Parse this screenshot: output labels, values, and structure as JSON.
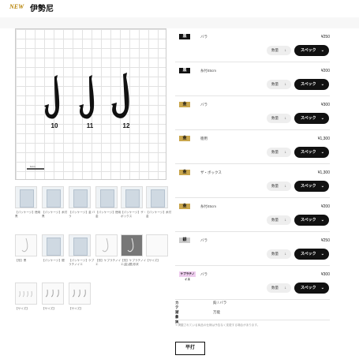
{
  "header": {
    "badge": "NEW",
    "title": "伊勢尼"
  },
  "main_image": {
    "hooks": [
      "10",
      "11",
      "12"
    ],
    "scale_label": "1mm"
  },
  "thumbnails": [
    {
      "caption": "【パッケージ】徳用 黒"
    },
    {
      "caption": "【パッケージ】糸付 黒"
    },
    {
      "caption": "【パッケージ】金 バラ"
    },
    {
      "caption": "【パッケージ】徳用 金"
    },
    {
      "caption": "【パッケージ】ザ・ボックス"
    },
    {
      "caption": "【パッケージ】糸付 金"
    },
    {
      "caption": "【形】黒"
    },
    {
      "caption": "【パッケージ】銀"
    },
    {
      "caption": "【パッケージ】ケプラチノイエ"
    },
    {
      "caption": "【形】ケプラチノイエ"
    },
    {
      "caption": "【形】ケプラチノイエ(金)(銀)形状"
    },
    {
      "caption": "【サイズ】"
    },
    {
      "caption": "【サイズ】"
    },
    {
      "caption": "【サイズ】"
    },
    {
      "caption": "【サイズ】"
    }
  ],
  "products": [
    {
      "badge": "黒",
      "badge_color": "#111111",
      "label": "バラ",
      "price": "¥250",
      "qty": "数量",
      "spec": "スペック"
    },
    {
      "badge": "黒",
      "badge_color": "#111111",
      "label": "糸付45cm",
      "price": "¥200",
      "qty": "数量",
      "spec": "スペック"
    },
    {
      "badge": "金",
      "badge_color": "#c9a64d",
      "label": "バラ",
      "price": "¥300",
      "qty": "数量",
      "spec": "スペック"
    },
    {
      "badge": "金",
      "badge_color": "#c9a64d",
      "label": "徳用",
      "price": "¥1,300",
      "qty": "数量",
      "spec": "スペック"
    },
    {
      "badge": "金",
      "badge_color": "#c9a64d",
      "label": "ザ・ボックス",
      "price": "¥1,300",
      "qty": "数量",
      "spec": "スペック"
    },
    {
      "badge": "金",
      "badge_color": "#c9a64d",
      "label": "糸付45cm",
      "price": "¥200",
      "qty": "数量",
      "spec": "スペック"
    },
    {
      "badge": "銀",
      "badge_color": "#cccccc",
      "label": "バラ",
      "price": "¥250",
      "qty": "数量",
      "spec": "スペック"
    },
    {
      "badge": "ケプラチノイエ",
      "badge_color": "#eeccee",
      "label": "バラ",
      "price": "¥300",
      "qty": "数量",
      "spec": "スペック"
    }
  ],
  "meta": {
    "category_key": "カテゴリ",
    "category_value": "鈎 / バラ",
    "type_key": "対象魚",
    "type_value": "万能"
  },
  "note": "※掲載されている商品の仕様は予告なく変更する場合があります。",
  "tags": {
    "heira": "平打"
  }
}
